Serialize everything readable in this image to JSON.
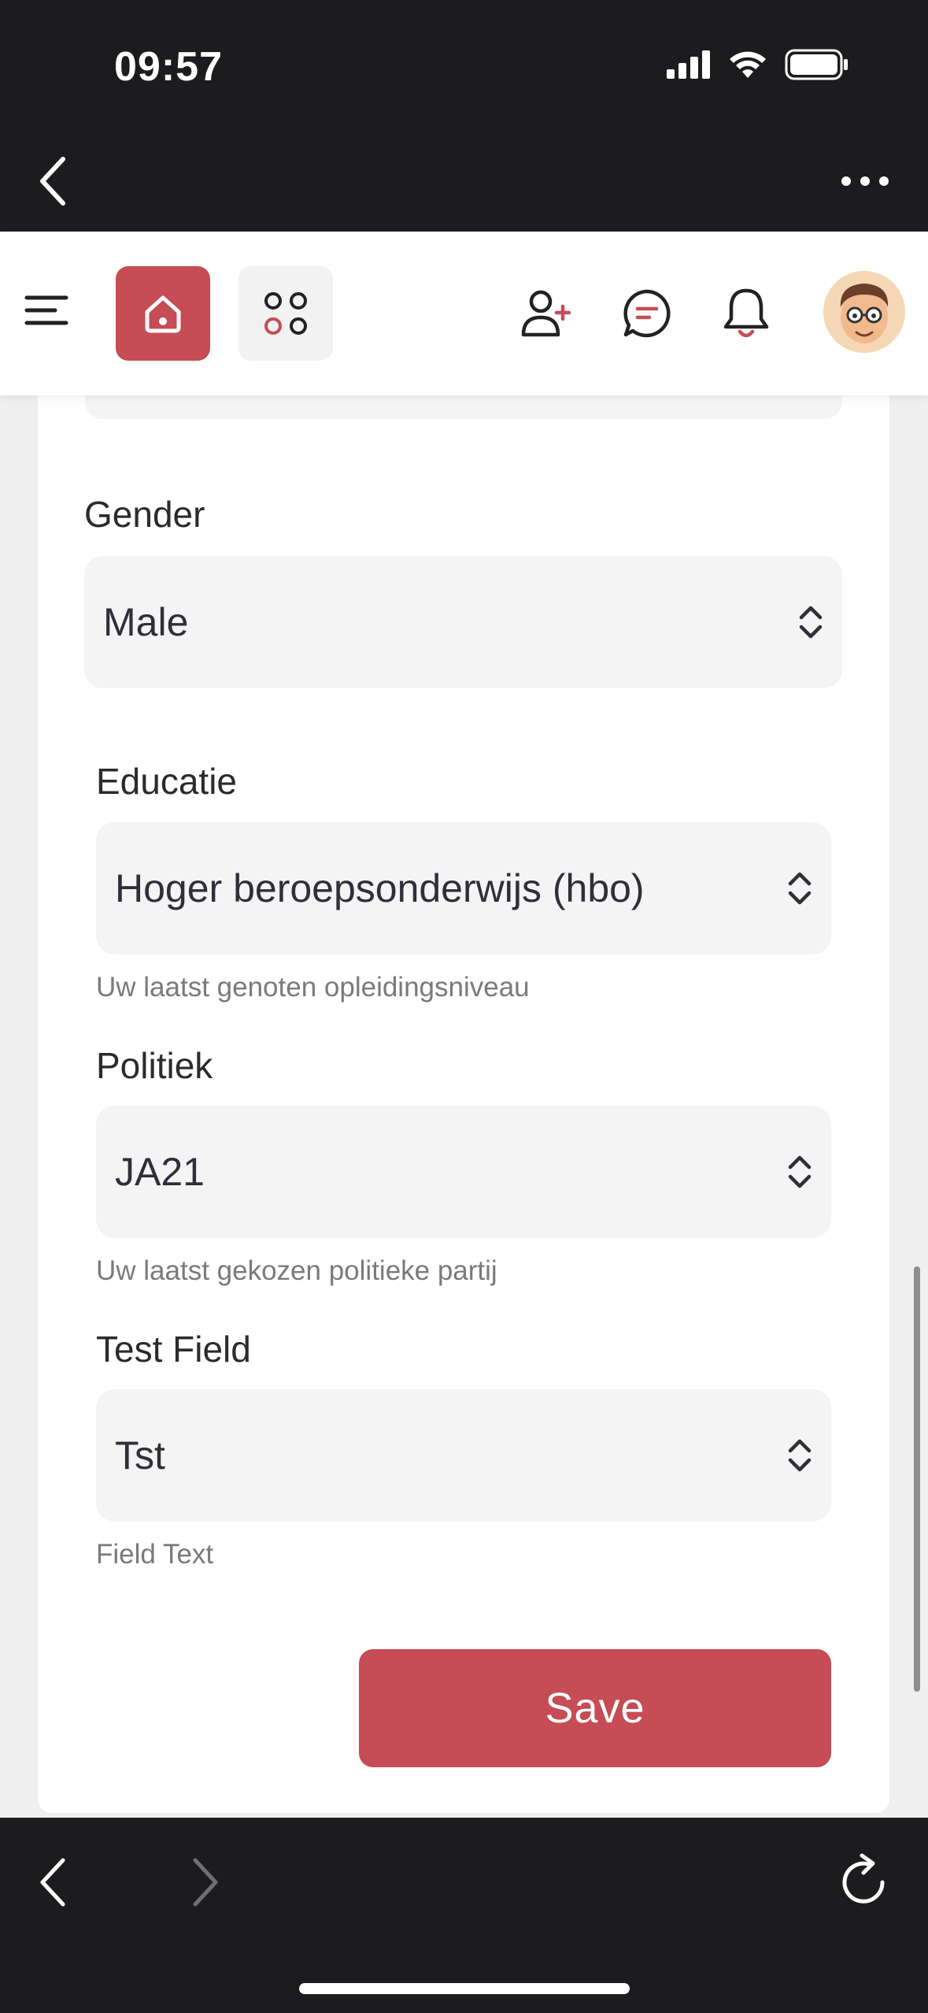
{
  "status_bar": {
    "time": "09:57"
  },
  "form": {
    "gender": {
      "label": "Gender",
      "value": "Male"
    },
    "educatie": {
      "label": "Educatie",
      "value": "Hoger beroepsonderwijs (hbo)",
      "help": "Uw laatst genoten opleidingsniveau"
    },
    "politiek": {
      "label": "Politiek",
      "value": "JA21",
      "help": "Uw laatst gekozen politieke partij"
    },
    "test_field": {
      "label": "Test Field",
      "value": "Tst",
      "help": "Field Text"
    },
    "save_label": "Save"
  },
  "colors": {
    "accent": "#c64c55",
    "field_bg": "#f4f4f4",
    "page_bg": "#efefef",
    "chrome_bg": "#1c1c1e"
  },
  "icons": [
    "back-icon",
    "more-icon",
    "menu-icon",
    "home-icon",
    "apps-icon",
    "add-user-icon",
    "chat-icon",
    "bell-icon",
    "avatar",
    "forward-icon",
    "reload-icon"
  ]
}
